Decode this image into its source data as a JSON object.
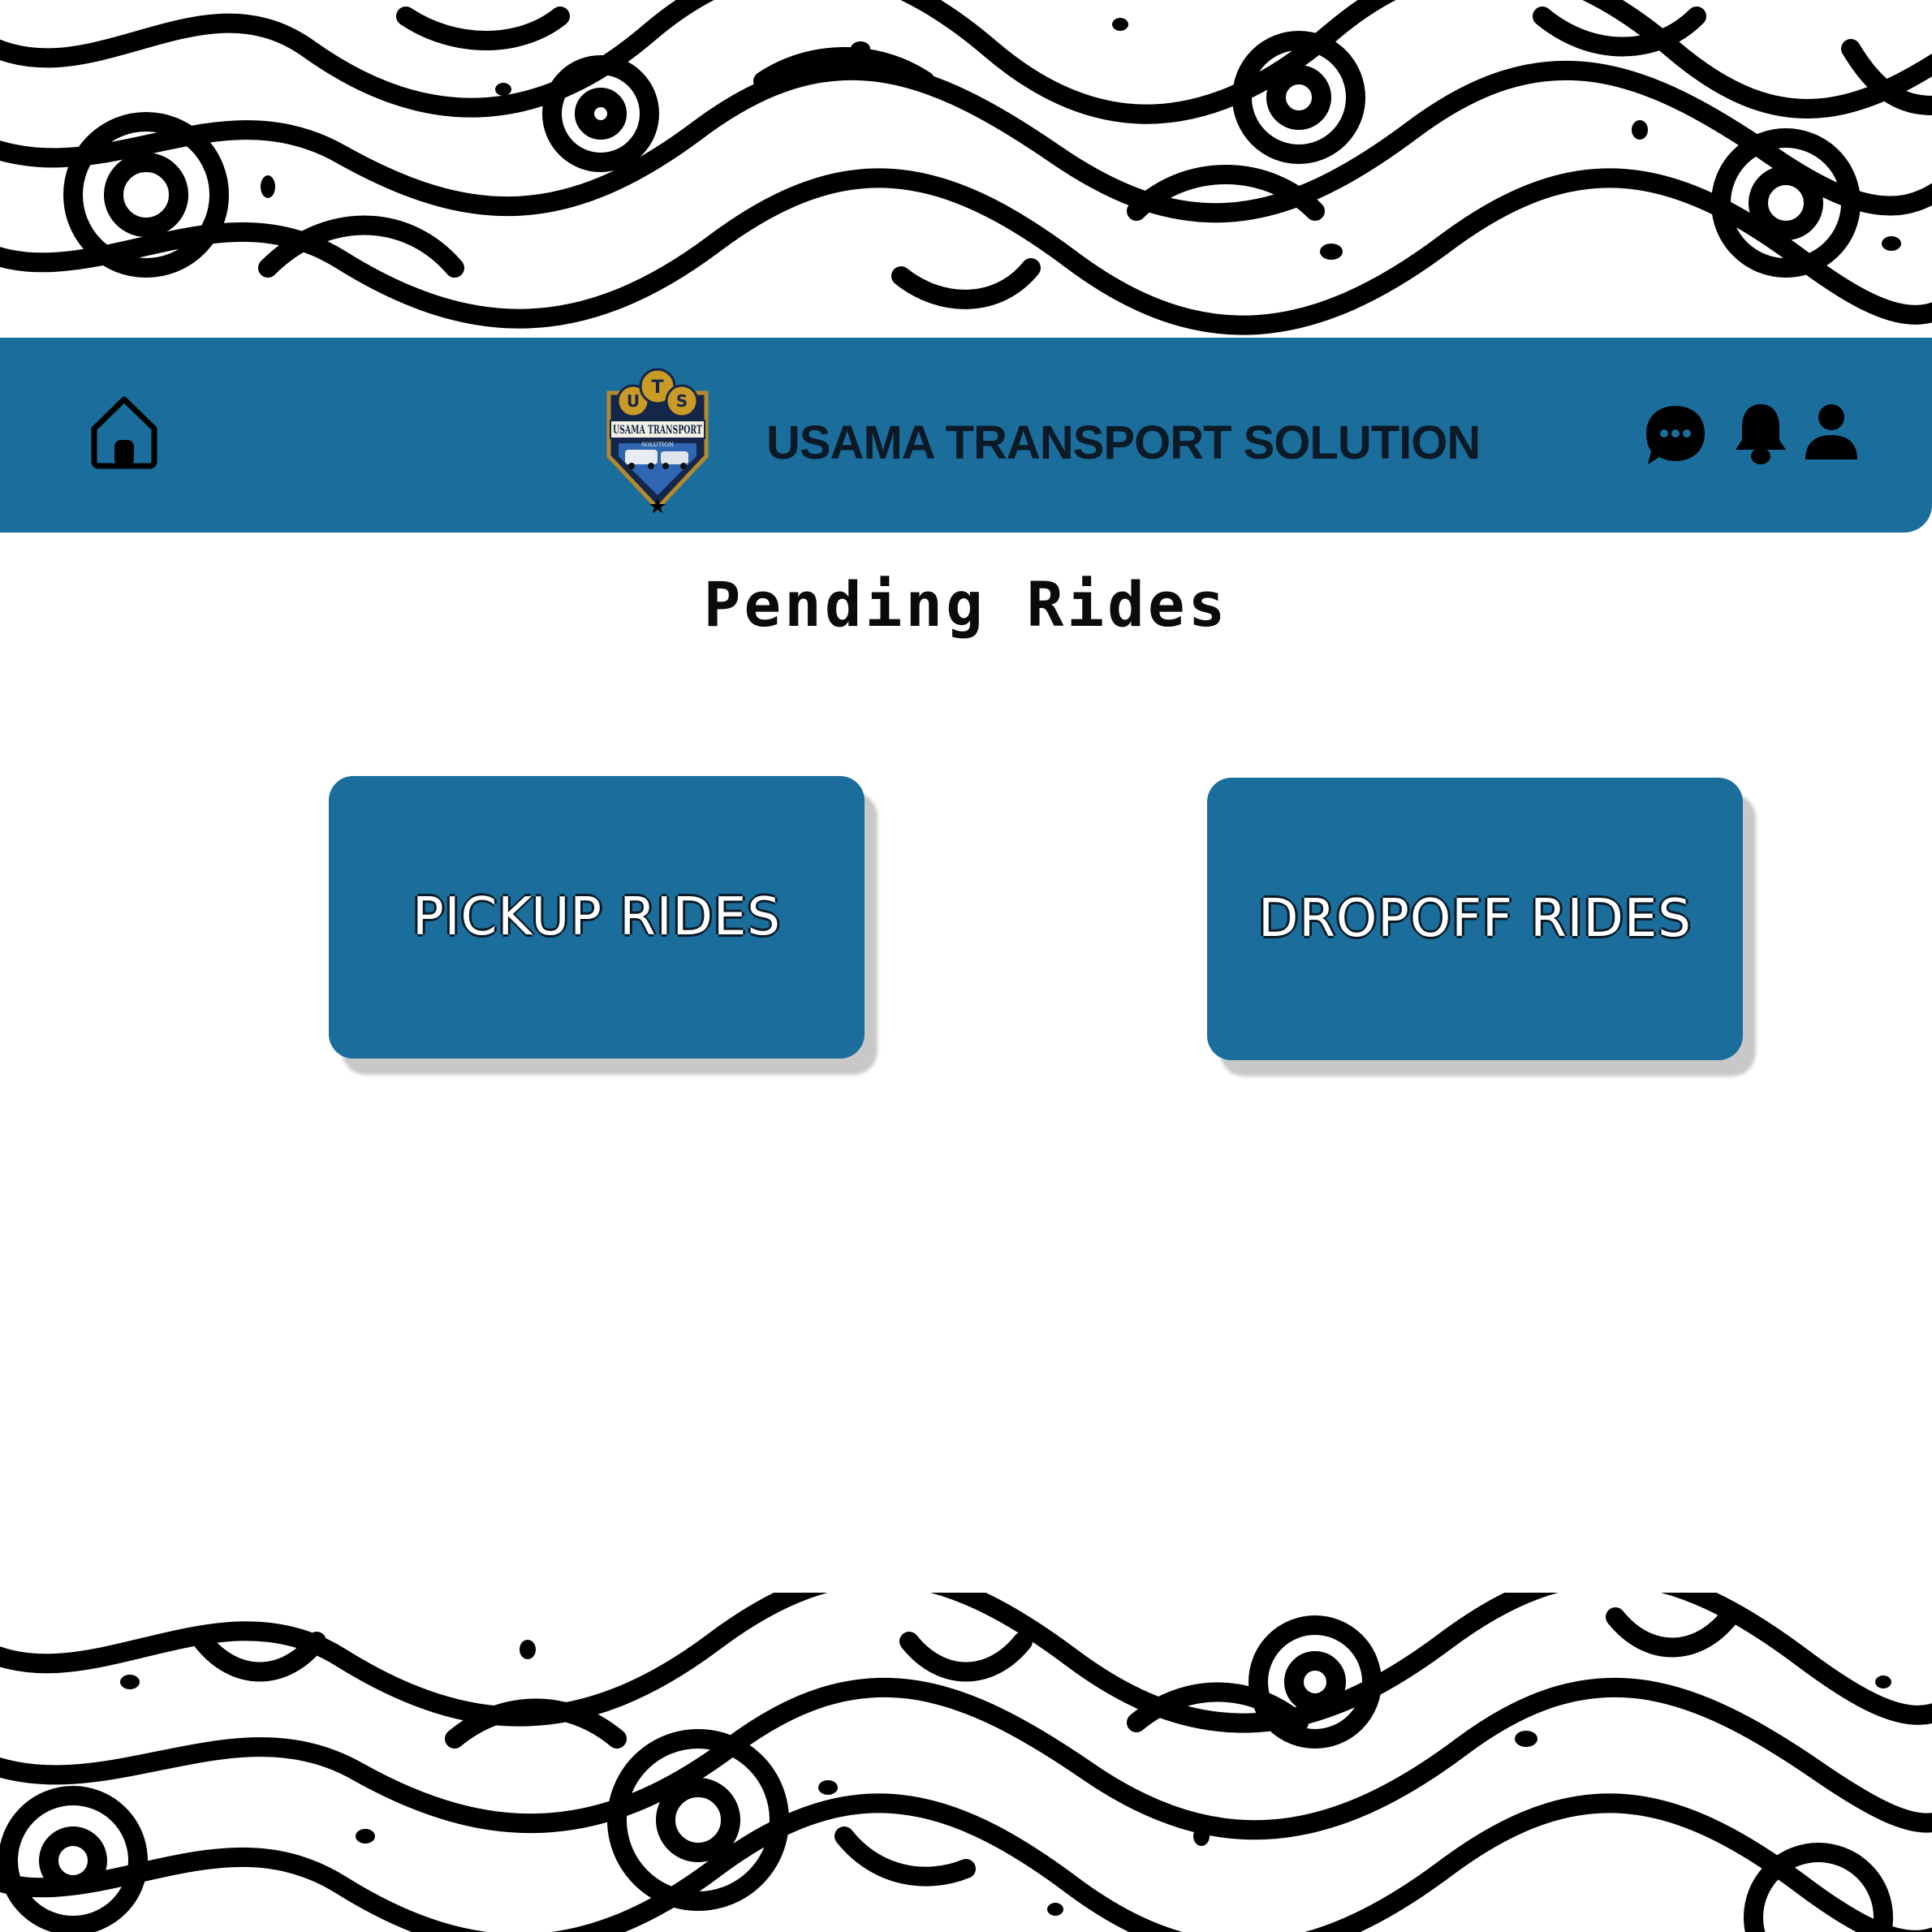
{
  "header": {
    "title": "USAMA TRANSPORT SOLUTION",
    "logo": {
      "monogram": "UTS",
      "name": "USAMA TRANSPORT",
      "tagline": "SOLUTION"
    },
    "icons": [
      "home-icon",
      "chat-icon",
      "bell-icon",
      "user-icon"
    ]
  },
  "main": {
    "title": "Pending Rides",
    "cards": [
      {
        "label": "PICKUP RIDES"
      },
      {
        "label": "DROPOFF RIDES"
      }
    ]
  },
  "colors": {
    "primary": "#1b6e9b",
    "text_dark": "#0b1a26",
    "pattern": "#000000",
    "background": "#ffffff"
  }
}
